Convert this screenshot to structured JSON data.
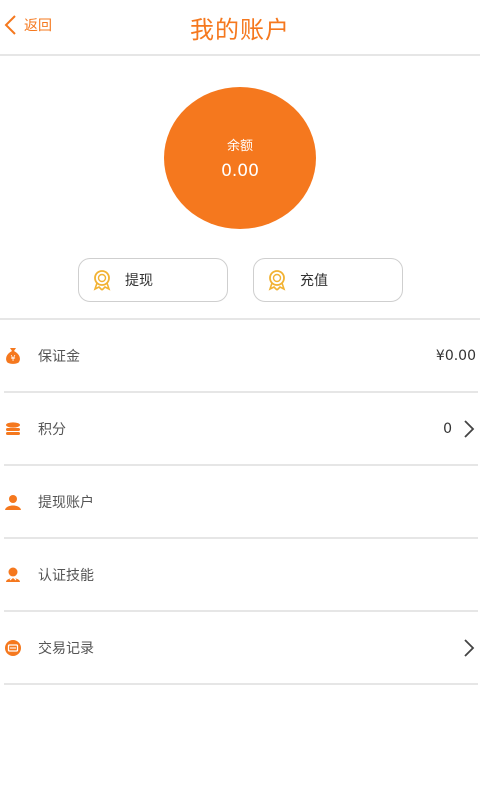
{
  "header": {
    "back_label": "返回",
    "title": "我的账户"
  },
  "balance": {
    "label": "余额",
    "value": "0.00"
  },
  "actions": {
    "withdraw_label": "提现",
    "recharge_label": "充值"
  },
  "list": {
    "items": [
      {
        "label": "保证金",
        "value": "¥0.00",
        "icon": "money-bag-icon"
      },
      {
        "label": "积分",
        "value": "0",
        "icon": "coin-stack-icon"
      },
      {
        "label": "提现账户",
        "value": "",
        "icon": "person-icon"
      },
      {
        "label": "认证技能",
        "value": "",
        "icon": "certified-user-icon"
      },
      {
        "label": "交易记录",
        "value": "",
        "icon": "record-icon"
      }
    ]
  },
  "colors": {
    "accent": "#f5781e",
    "divider": "#e6e6e6",
    "medal": "#f2b233"
  }
}
